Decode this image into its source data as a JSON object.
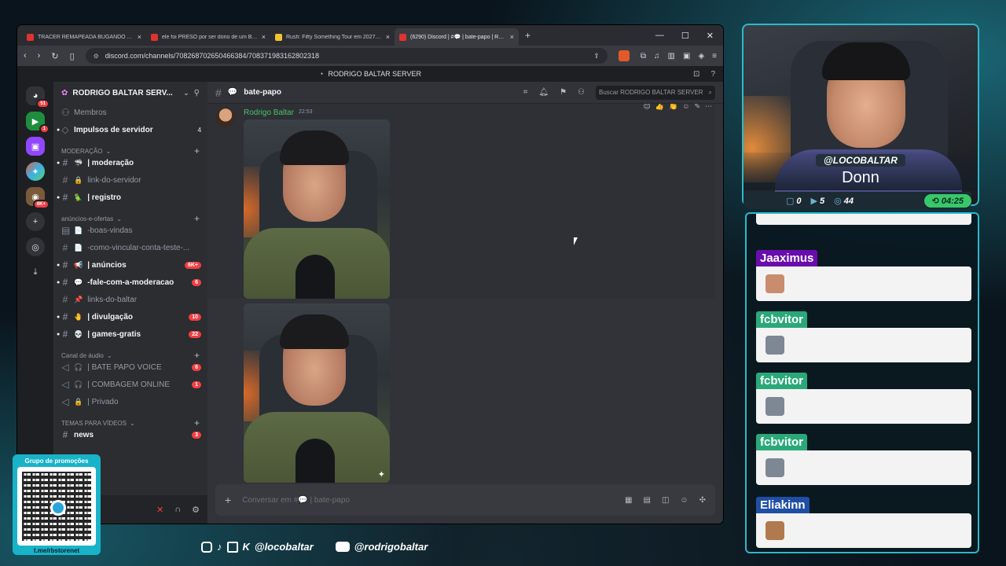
{
  "browser": {
    "tabs": [
      {
        "label": "TRACER REMAPEADA BUGANDO A ZONA NO",
        "fav_color": "#e0322f",
        "active": false
      },
      {
        "label": "ele foi PRESO por ser dono de um BAILE FUNK",
        "fav_color": "#e0322f",
        "active": false
      },
      {
        "label": "Rush: Fifty Something Tour em 2027 no Brasil",
        "fav_color": "#f1c232",
        "active": false
      },
      {
        "label": "(6290) Discord | #💬 | bate-papo | RODRIGO",
        "fav_color": "#e0322f",
        "active": true
      }
    ],
    "url": "discord.com/channels/708268702650466384/708371983162802318"
  },
  "discord": {
    "window_title": "RODRIGO BALTAR SERVER",
    "guild_badges": {
      "home": "51",
      "g1": "1",
      "g4": "6K+"
    },
    "server_name": "RODRIGO BALTAR SERV...",
    "top_rows": [
      {
        "icon": "👥",
        "name": "Membros",
        "unread": false
      },
      {
        "icon": "💎",
        "name": "Impulsos de servidor",
        "unread": true,
        "count": "4"
      }
    ],
    "categories": [
      {
        "name": "MODERAÇÃO",
        "channels": [
          {
            "emoji": "🦈",
            "name": "| moderação",
            "unread": true
          },
          {
            "emoji": "🔒",
            "name": "link-do-servidor",
            "unread": false
          },
          {
            "emoji": "🦜",
            "name": "| registro",
            "unread": true
          }
        ]
      },
      {
        "name": "anúncios-e-ofertas",
        "channels": [
          {
            "emoji": "📄",
            "name": "-boas-vindas",
            "unread": false
          },
          {
            "emoji": "📄",
            "name": "-como-vincular-conta-teste-...",
            "unread": false
          },
          {
            "emoji": "📢",
            "name": "| anúncios",
            "unread": true,
            "count": "6K+"
          },
          {
            "emoji": "💬",
            "name": "-fale-com-a-moderacao",
            "unread": true,
            "count": "6"
          },
          {
            "emoji": "📌",
            "name": "links-do-baltar",
            "unread": false
          },
          {
            "emoji": "🤚",
            "name": "| divulgação",
            "unread": true,
            "count": "10"
          },
          {
            "emoji": "💀",
            "name": "| games-gratis",
            "unread": true,
            "count": "22"
          }
        ]
      },
      {
        "name": "Canal de áudio",
        "channels": [
          {
            "emoji": "🎧",
            "name": "| BATE PAPO VOICE",
            "unread": false,
            "count": "6"
          },
          {
            "emoji": "🎧",
            "name": "| COMBAGEM ONLINE",
            "unread": false,
            "count": "1"
          },
          {
            "emoji": "🔒",
            "name": "| Privado",
            "unread": false
          }
        ]
      },
      {
        "name": "TEMAS PARA VÍDEOS",
        "channels": [
          {
            "emoji": "",
            "name": "news",
            "unread": true,
            "count": "3"
          }
        ]
      }
    ],
    "channel_name": "bate-papo",
    "search_placeholder": "Buscar RODRIGO BALTAR SERVER",
    "message": {
      "author": "Rodrigo Baltar",
      "timestamp": "22:53"
    },
    "composer_placeholder": "Conversar em #💬 | bate-papo"
  },
  "stream": {
    "handle": "@LOCOBALTAR",
    "name": "Donn",
    "stats": {
      "comments": "0",
      "videos": "5",
      "followers": "44",
      "timer": "04:25"
    },
    "chat": [
      {
        "user": "Jaaximus",
        "color": "#6a0dad"
      },
      {
        "user": "fcbvitor",
        "color": "#2aa87a"
      },
      {
        "user": "fcbvitor",
        "color": "#2aa87a"
      },
      {
        "user": "fcbvitor",
        "color": "#2aa87a"
      },
      {
        "user": "Eliakinn",
        "color": "#1f4fa5"
      }
    ],
    "socials": {
      "primary": "@locobaltar",
      "youtube": "@rodrigobaltar"
    },
    "promo": {
      "title": "Grupo de promoções",
      "url": "t.me/rbstorenet"
    }
  }
}
